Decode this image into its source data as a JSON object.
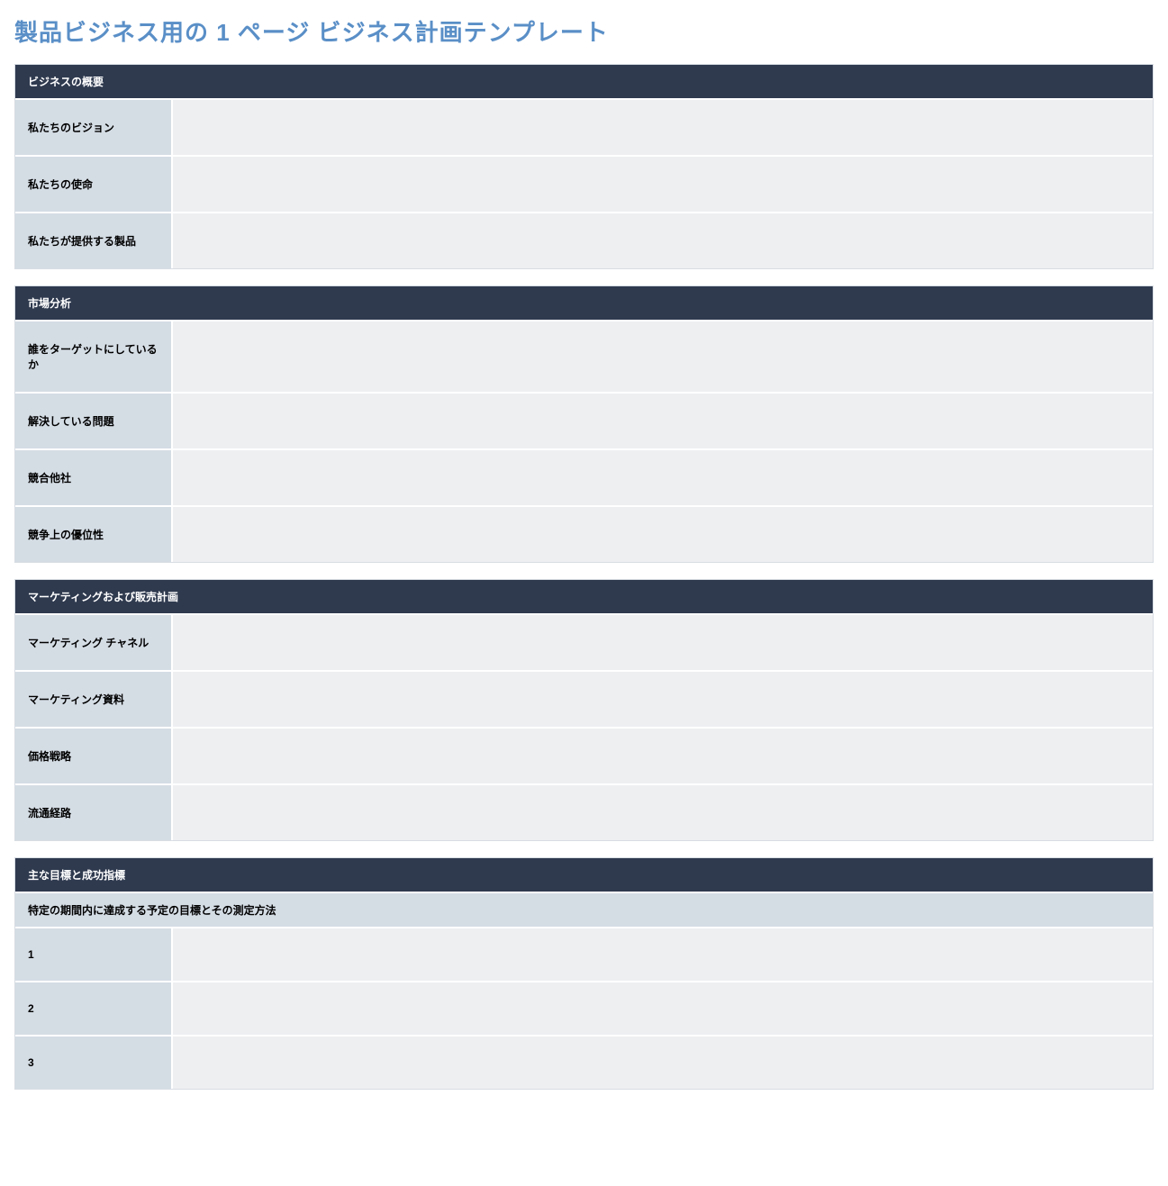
{
  "title": "製品ビジネス用の 1 ページ ビジネス計画テンプレート",
  "sections": [
    {
      "header": "ビジネスの概要",
      "rows": [
        {
          "label": "私たちのビジョン",
          "value": ""
        },
        {
          "label": "私たちの使命",
          "value": ""
        },
        {
          "label": "私たちが提供する製品",
          "value": ""
        }
      ]
    },
    {
      "header": "市場分析",
      "rows": [
        {
          "label": "誰をターゲットにしているか",
          "value": ""
        },
        {
          "label": "解決している問題",
          "value": ""
        },
        {
          "label": "競合他社",
          "value": ""
        },
        {
          "label": "競争上の優位性",
          "value": ""
        }
      ]
    },
    {
      "header": "マーケティングおよび販売計画",
      "rows": [
        {
          "label": "マーケティング チャネル",
          "value": ""
        },
        {
          "label": "マーケティング資料",
          "value": ""
        },
        {
          "label": "価格戦略",
          "value": ""
        },
        {
          "label": "流通経路",
          "value": ""
        }
      ]
    },
    {
      "header": "主な目標と成功指標",
      "subheader": "特定の期間内に達成する予定の目標とその測定方法",
      "rows": [
        {
          "label": "1",
          "value": ""
        },
        {
          "label": "2",
          "value": ""
        },
        {
          "label": "3",
          "value": ""
        }
      ]
    }
  ]
}
